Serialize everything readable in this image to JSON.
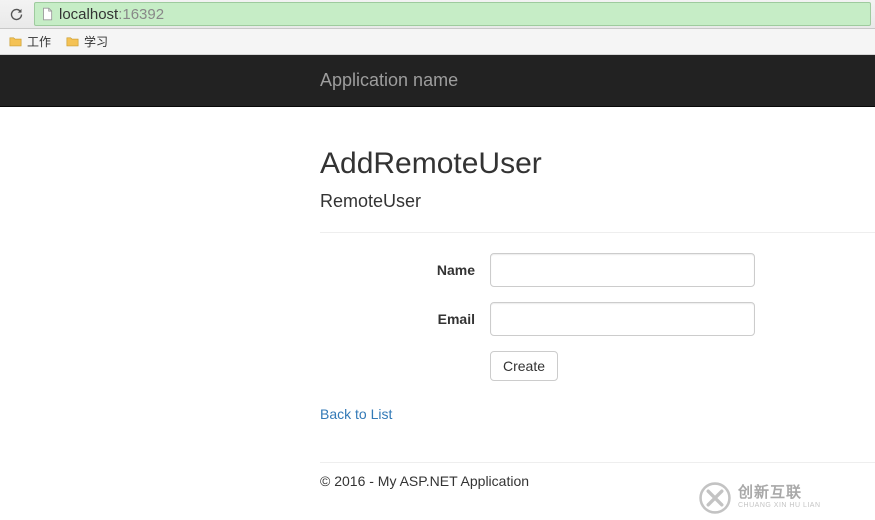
{
  "browser": {
    "url_host": "localhost",
    "url_port": ":16392"
  },
  "bookmarks": {
    "items": [
      {
        "label": "工作"
      },
      {
        "label": "学习"
      }
    ]
  },
  "navbar": {
    "brand": "Application name"
  },
  "page": {
    "heading": "AddRemoteUser",
    "subheading": "RemoteUser"
  },
  "form": {
    "name_label": "Name",
    "name_value": "",
    "email_label": "Email",
    "email_value": "",
    "submit_label": "Create"
  },
  "links": {
    "back_to_list": "Back to List"
  },
  "footer": {
    "text": "© 2016 - My ASP.NET Application"
  },
  "watermark": {
    "cn": "创新互联",
    "en": "CHUANG XIN HU LIAN"
  }
}
